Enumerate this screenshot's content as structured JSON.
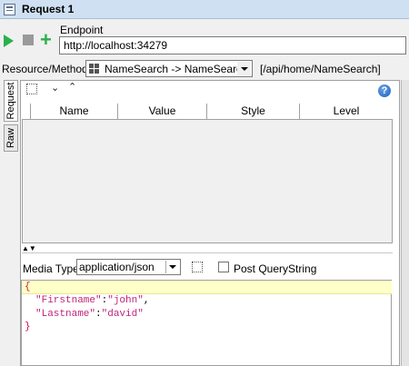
{
  "window": {
    "title": "Request 1"
  },
  "toolbar": {
    "run_icon": "play-icon",
    "stop_icon": "stop-icon",
    "add_icon": "plus-icon",
    "add_glyph": "+"
  },
  "endpoint": {
    "label": "Endpoint",
    "value": "http://localhost:34279"
  },
  "resource": {
    "label": "Resource/Method:",
    "selected": "NameSearch -> NameSearc...",
    "path": "[/api/home/NameSearch]"
  },
  "tabs": [
    "Request",
    "Raw"
  ],
  "params_toolbar": {
    "down_glyph": "⌄",
    "up_glyph": "⌃",
    "help_glyph": "?"
  },
  "params_table": {
    "columns": [
      "Name",
      "Value",
      "Style",
      "Level"
    ],
    "rows": []
  },
  "splitter_glyph": "▲▼",
  "media": {
    "label": "Media Type",
    "value": "application/json",
    "post_querystring_label": "Post QueryString",
    "post_querystring_checked": false
  },
  "body": {
    "open": "{",
    "line2_key": "\"Firstname\"",
    "line2_sep": ":",
    "line2_val": "\"john\"",
    "line2_end": ",",
    "line3_key": "\"Lastname\"",
    "line3_sep": ":",
    "line3_val": "\"david\"",
    "close": "}"
  },
  "colors": {
    "accent_green": "#2bb14b",
    "current_line": "#ffffc8",
    "json_string": "#c0247a"
  }
}
